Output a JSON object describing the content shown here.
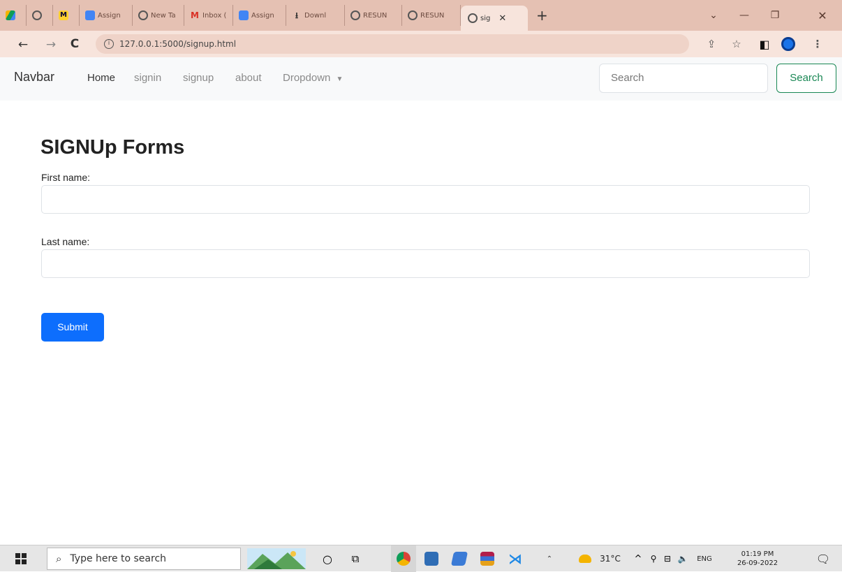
{
  "browser": {
    "tabs": [
      {
        "label": "",
        "icon": "google-drive-icon"
      },
      {
        "label": "",
        "icon": "globe-icon"
      },
      {
        "label": "",
        "icon": "miro-icon"
      },
      {
        "label": "Assign",
        "icon": "docs-icon"
      },
      {
        "label": "New Ta",
        "icon": "chrome-icon"
      },
      {
        "label": "Inbox (",
        "icon": "gmail-icon"
      },
      {
        "label": "Assign",
        "icon": "docs-icon"
      },
      {
        "label": "Downl",
        "icon": "download-icon"
      },
      {
        "label": "RESUN",
        "icon": "globe-icon"
      },
      {
        "label": "RESUN",
        "icon": "globe-icon"
      }
    ],
    "active_tab": {
      "label": "sig",
      "icon": "globe-icon"
    },
    "url": "127.0.0.1:5000/signup.html"
  },
  "navbar": {
    "brand": "Navbar",
    "links": [
      "Home",
      "signin",
      "signup",
      "about",
      "Dropdown"
    ],
    "search_placeholder": "Search",
    "search_button": "Search"
  },
  "form": {
    "title": "SIGNUp Forms",
    "first_name_label": "First name:",
    "first_name_value": "",
    "last_name_label": "Last name:",
    "last_name_value": "",
    "submit_label": "Submit"
  },
  "taskbar": {
    "search_placeholder": "Type here to search",
    "temperature": "31°C",
    "language": "ENG",
    "time": "01:19 PM",
    "date": "26-09-2022"
  },
  "colors": {
    "tab_strip": "#e5c1b3",
    "toolbar": "#f7e4dc",
    "primary": "#0d6efd",
    "success": "#198754"
  }
}
